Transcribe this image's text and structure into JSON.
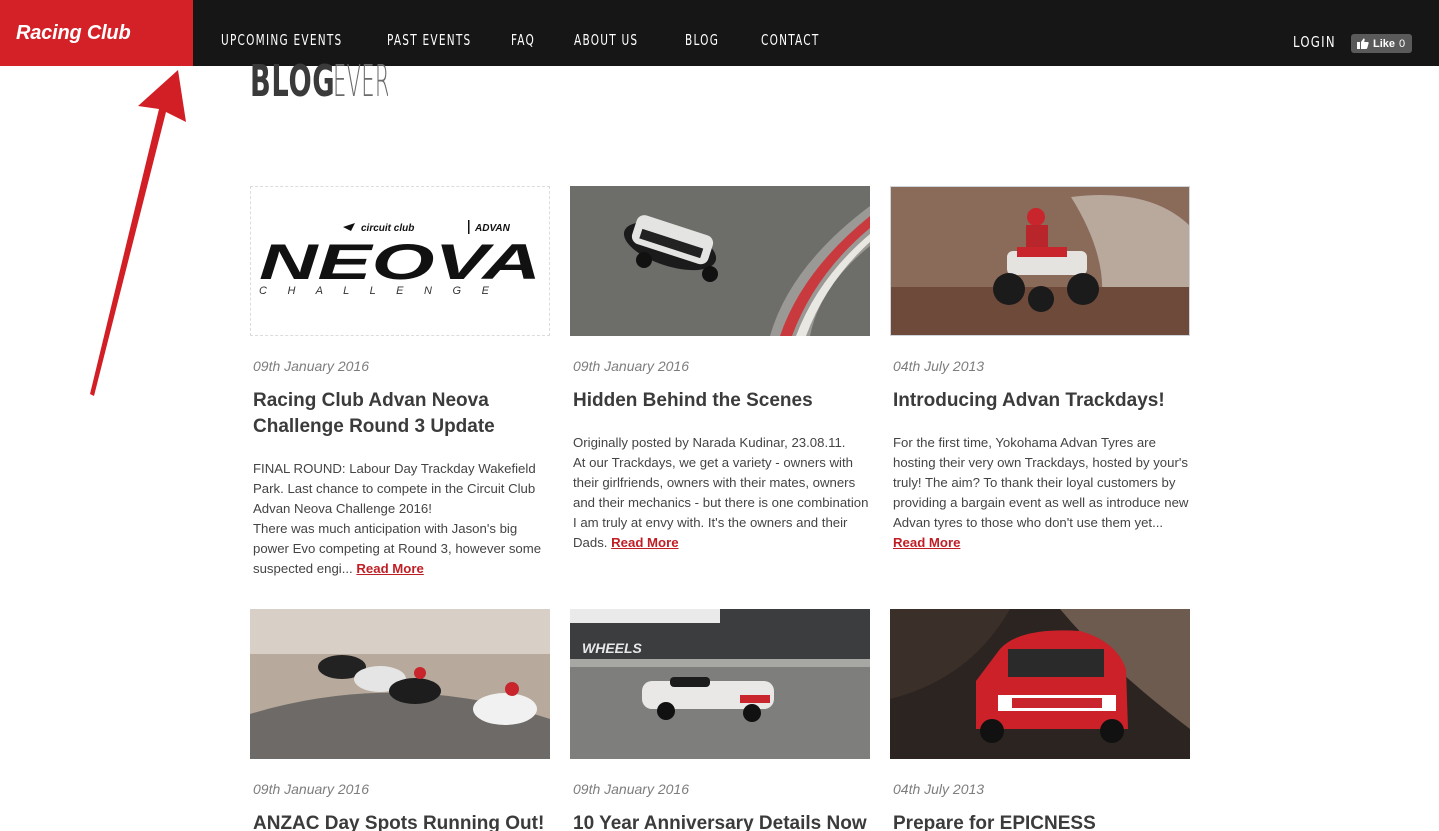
{
  "site": {
    "logo_text": "Racing Club"
  },
  "nav": {
    "items": [
      {
        "label": "UPCOMING EVENTS"
      },
      {
        "label": "PAST EVENTS"
      },
      {
        "label": "FAQ"
      },
      {
        "label": "ABOUT US"
      },
      {
        "label": "BLOG"
      },
      {
        "label": "CONTACT"
      }
    ],
    "login_label": "LOGIN",
    "like_label": "Like",
    "like_count": "0"
  },
  "heading": {
    "strong": "BLOG",
    "light": "EVERYTHING ABOUT RACING CLUB"
  },
  "posts": [
    {
      "date": "09th January 2016",
      "title": "Racing Club Advan Neova Challenge Round 3 Update",
      "excerpt": "FINAL ROUND: Labour Day Trackday Wakefield Park. Last chance to compete in the Circuit Club Advan Neova Challenge 2016!\nThere was much anticipation with Jason's big power Evo competing at Round 3, however some suspected engi...",
      "read_more": "Read More",
      "image": {
        "type": "logo",
        "brand_line": "circuit club | ADVAN",
        "main": "NEOVA",
        "sub": "C H A L L E N G E"
      }
    },
    {
      "date": "09th January 2016",
      "title": "Hidden Behind the Scenes",
      "excerpt": "Originally posted by Narada Kudinar, 23.08.11.\nAt our Trackdays, we get a variety - owners with their girlfriends, owners with their mates, owners and their mechanics - but there is one combination I am truly at envy with. It's the owners and their Dads.",
      "read_more": "Read More",
      "image": {
        "type": "photo",
        "subject": "race car on track corner"
      }
    },
    {
      "date": "04th July 2013",
      "title": "Introducing Advan Trackdays!",
      "excerpt": "For the first time, Yokohama Advan Tyres are hosting their very own Trackdays, hosted by your's truly! The aim? To thank their loyal customers by providing a bargain event as well as introduce new Advan tyres to those who don't use them yet...",
      "read_more": "Read More",
      "image": {
        "type": "photo",
        "subject": "quad bike on dirt"
      }
    },
    {
      "date": "09th January 2016",
      "title": "ANZAC Day Spots Running Out!",
      "excerpt": "",
      "read_more": "",
      "image": {
        "type": "photo",
        "subject": "motorcycles racing"
      }
    },
    {
      "date": "09th January 2016",
      "title": "10 Year Anniversary Details Now",
      "excerpt": "",
      "read_more": "",
      "image": {
        "type": "photo",
        "subject": "prototype race car",
        "sign": "WHEELS"
      }
    },
    {
      "date": "04th July 2013",
      "title": "Prepare for EPICNESS",
      "excerpt": "",
      "read_more": "",
      "image": {
        "type": "photo",
        "subject": "red rally car"
      }
    }
  ],
  "colors": {
    "brand_red": "#d42027",
    "nav_bg": "#161616",
    "link_red": "#c01e25",
    "arrow_red": "#d21f26"
  }
}
